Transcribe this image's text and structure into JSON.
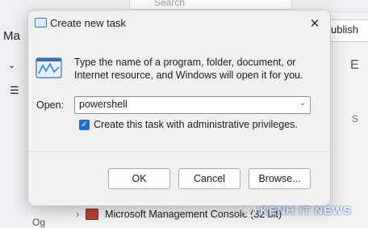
{
  "background": {
    "search_placeholder": "Search",
    "left_fragment": "Ma",
    "right_fragment": "ublish",
    "right_letter_e": "E",
    "right_letter_s": "S",
    "tree_item_label": "Microsoft Management Console (32 bit)",
    "sidebar_glyph": "Og",
    "watermark": "KENH IT NEWS"
  },
  "dialog": {
    "title": "Create new task",
    "close_glyph": "✕",
    "description": "Type the name of a program, folder, document, or Internet resource, and Windows will open it for you.",
    "open_label": "Open:",
    "open_value": "powershell",
    "admin_checkbox_label": "Create this task with administrative privileges.",
    "admin_checked": true,
    "buttons": {
      "ok": "OK",
      "cancel": "Cancel",
      "browse": "Browse..."
    }
  },
  "colors": {
    "accent": "#1f6fc5",
    "dialog_bg": "#f0f0f0"
  }
}
